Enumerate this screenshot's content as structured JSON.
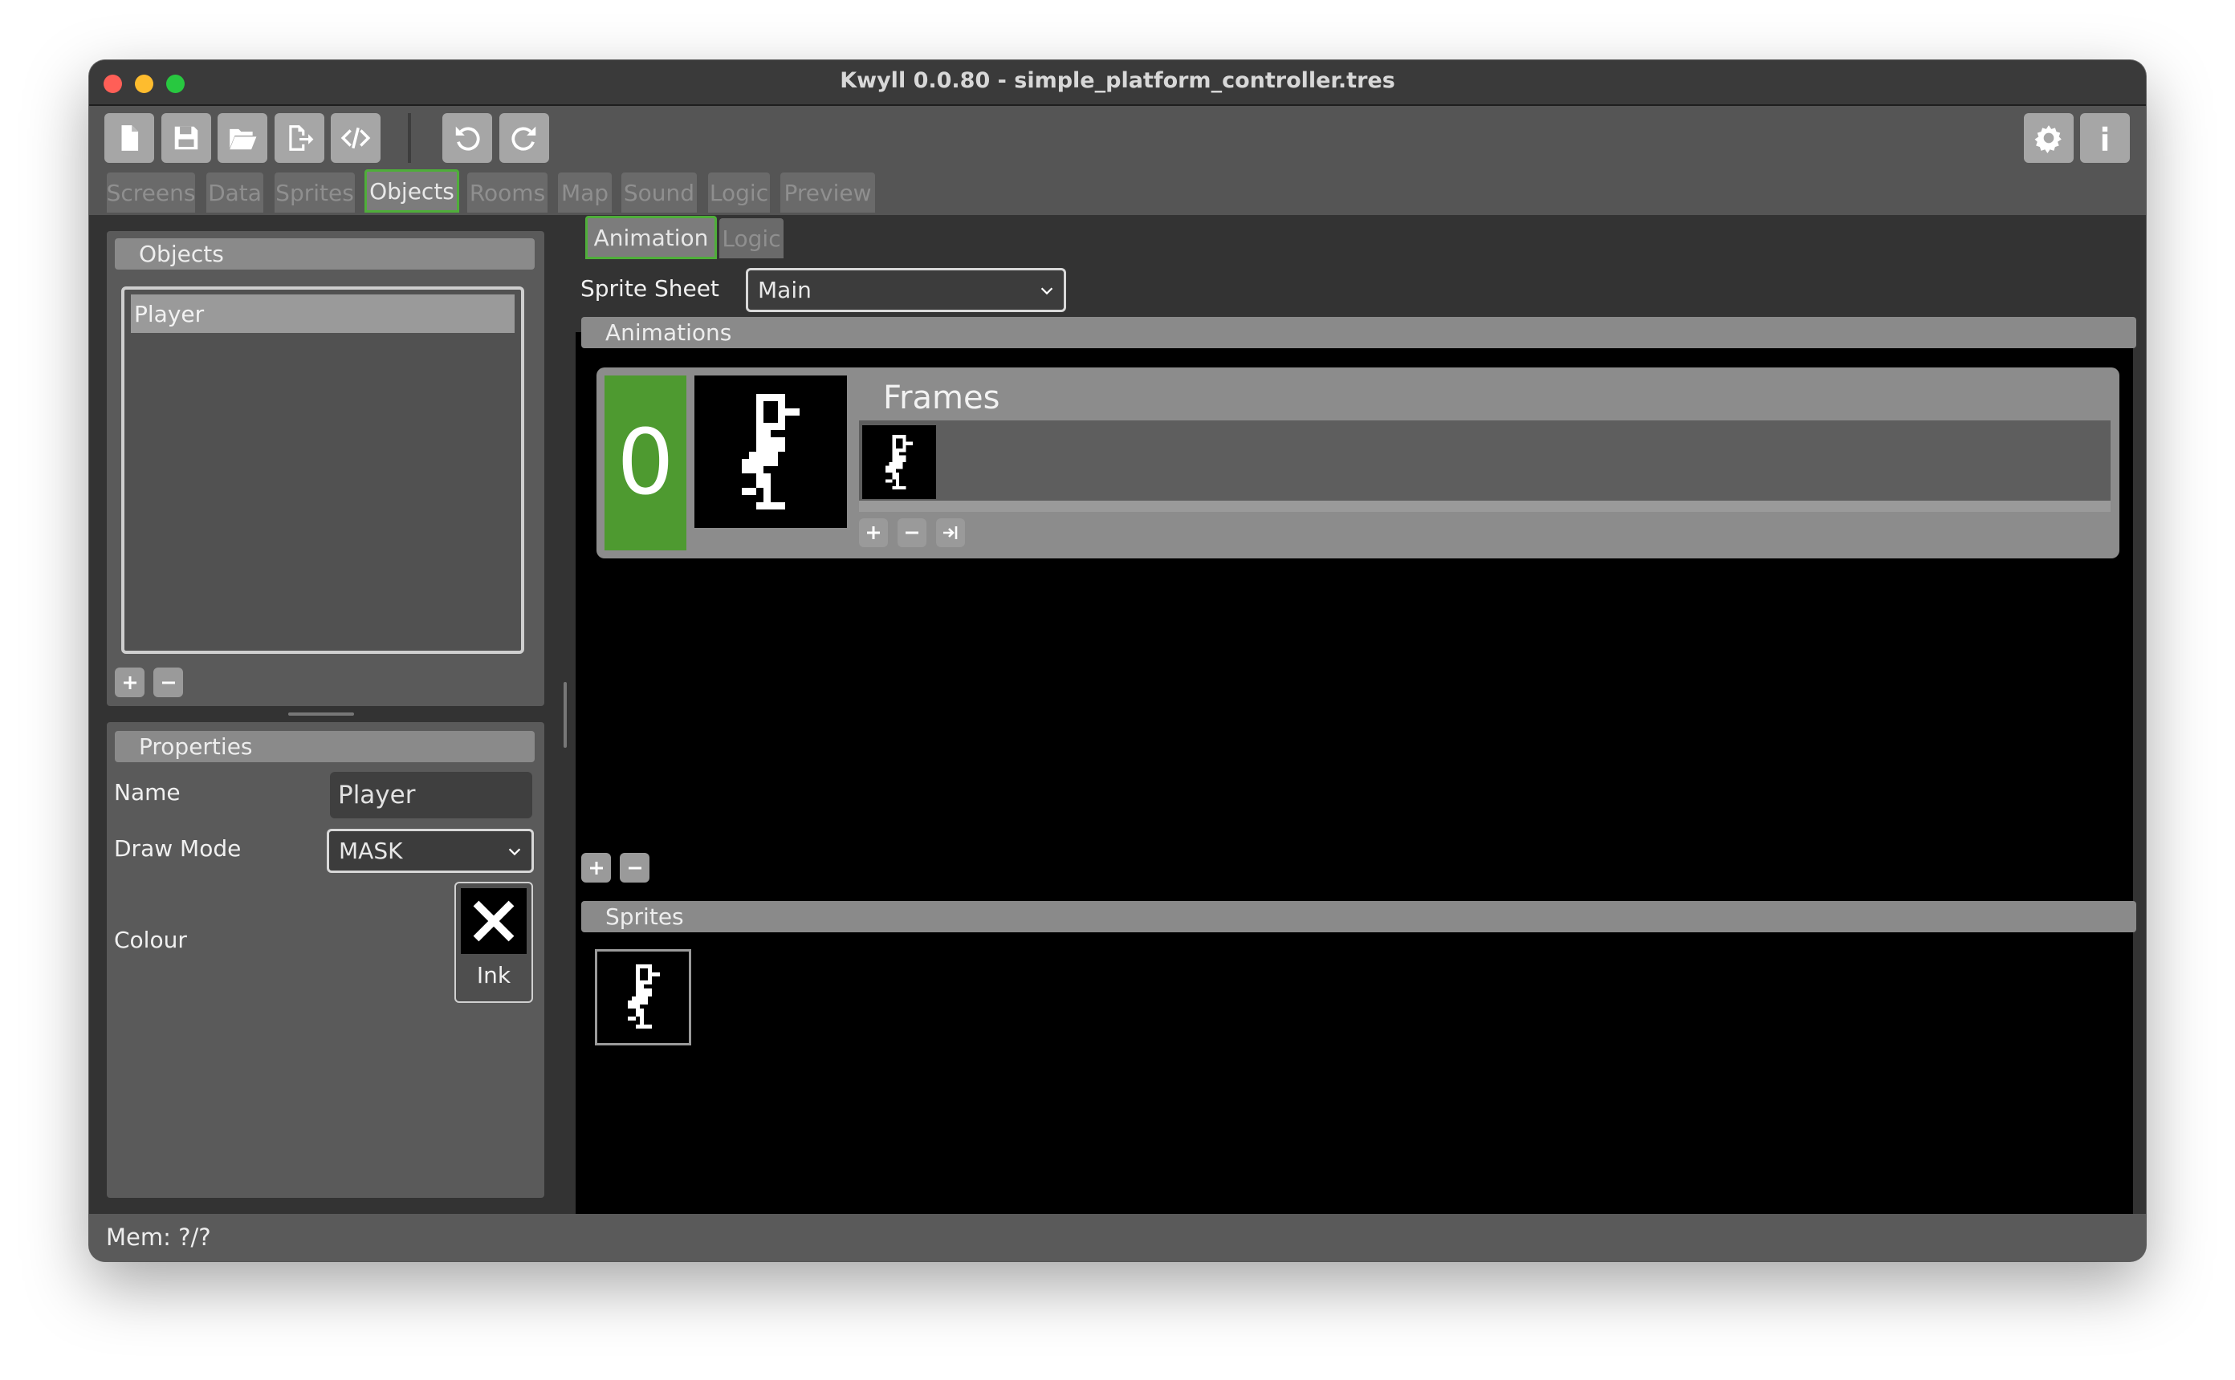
{
  "window": {
    "title": "Kwyll 0.0.80 - simple_platform_controller.tres"
  },
  "toolbar": {
    "left_buttons": [
      {
        "icon": "new-file-icon"
      },
      {
        "icon": "save-icon"
      },
      {
        "icon": "open-folder-icon"
      },
      {
        "icon": "export-icon"
      },
      {
        "icon": "code-icon"
      },
      {
        "icon": "undo-icon"
      },
      {
        "icon": "redo-icon"
      }
    ],
    "right_buttons": [
      {
        "icon": "gear-icon"
      },
      {
        "icon": "info-icon"
      }
    ]
  },
  "main_tabs": [
    "Screens",
    "Data",
    "Sprites",
    "Objects",
    "Rooms",
    "Map",
    "Sound",
    "Logic",
    "Preview"
  ],
  "active_main_tab": "Objects",
  "objects_panel": {
    "title": "Objects",
    "items": [
      "Player"
    ],
    "selected": "Player"
  },
  "properties": {
    "title": "Properties",
    "name_label": "Name",
    "name_value": "Player",
    "draw_mode_label": "Draw Mode",
    "draw_mode_value": "MASK",
    "colour_label": "Colour",
    "colour_value": "Ink"
  },
  "sub_tabs": [
    "Animation",
    "Logic"
  ],
  "active_sub_tab": "Animation",
  "sprite_sheet": {
    "label": "Sprite Sheet",
    "value": "Main"
  },
  "animations": {
    "title": "Animations",
    "items": [
      {
        "index": "0",
        "frames_title": "Frames",
        "frame_count": 1
      }
    ]
  },
  "sprites": {
    "title": "Sprites",
    "count": 1
  },
  "status": {
    "mem": "Mem: ?/?"
  },
  "colors": {
    "accent": "#4fae3a",
    "anim_index_bg": "#4e9a30"
  }
}
